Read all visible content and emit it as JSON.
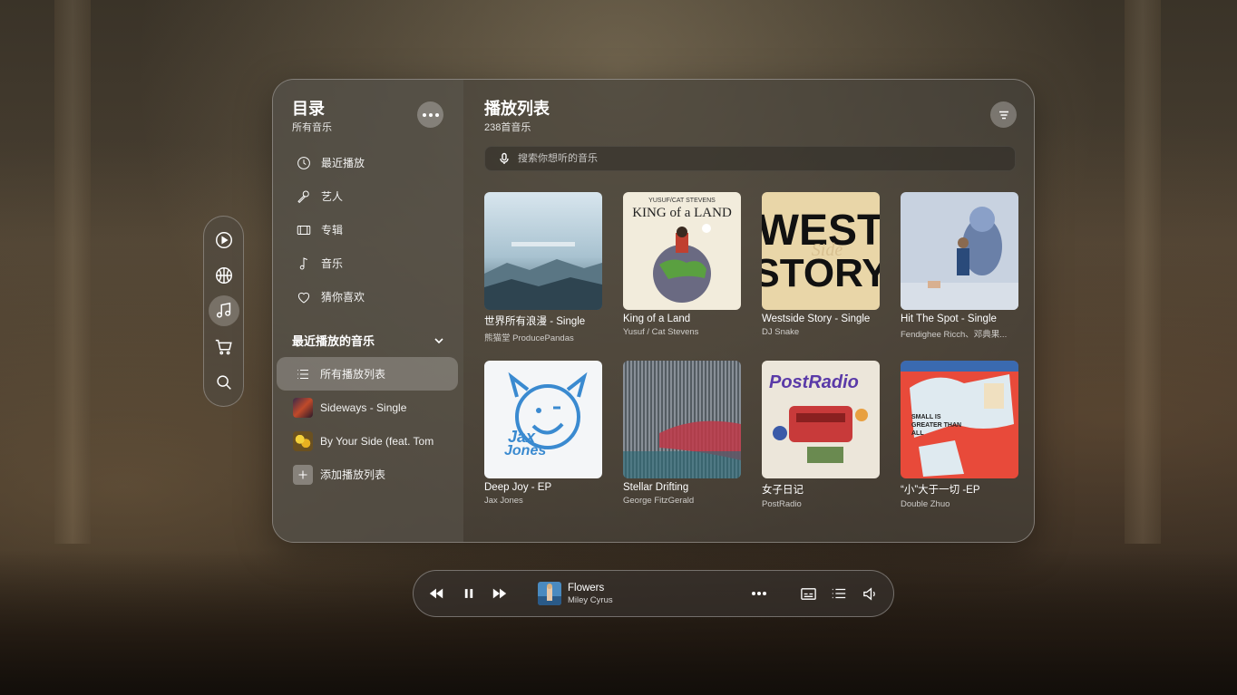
{
  "sidebar": {
    "title": "目录",
    "subtitle": "所有音乐",
    "menu": [
      {
        "label": "最近播放",
        "icon": "clock-icon"
      },
      {
        "label": "艺人",
        "icon": "microphone-icon"
      },
      {
        "label": "专辑",
        "icon": "album-icon"
      },
      {
        "label": "音乐",
        "icon": "music-note-icon"
      },
      {
        "label": "猜你喜欢",
        "icon": "heart-icon"
      }
    ],
    "section_title": "最近播放的音乐",
    "playlists": [
      {
        "label": "所有播放列表",
        "icon": "list-icon",
        "active": true
      },
      {
        "label": "Sideways - Single",
        "icon": "album-thumb"
      },
      {
        "label": "By Your Side (feat. Tom",
        "icon": "album-thumb"
      },
      {
        "label": "添加播放列表",
        "icon": "plus-icon"
      }
    ]
  },
  "content": {
    "title": "播放列表",
    "subtitle": "238首音乐",
    "search_placeholder": "搜索你想听的音乐",
    "albums": [
      {
        "title": "世界所有浪漫 - Single",
        "artist": "熊猫堂 ProducePandas"
      },
      {
        "title": "King of a Land",
        "artist": "Yusuf / Cat Stevens",
        "cover_text": "YUSUF/CAT STEVENS",
        "cover_text2": "KING of a LAND"
      },
      {
        "title": "Westside Story - Single",
        "artist": "DJ Snake",
        "cover_text": "WEST",
        "cover_text2": "STORY",
        "cover_text3": "Side"
      },
      {
        "title": "Hit The Spot - Single",
        "artist": "Fendighee Ricch、邓典果..."
      },
      {
        "title": "Deep Joy - EP",
        "artist": "Jax Jones",
        "cover_text": "Jax",
        "cover_text2": "Jones"
      },
      {
        "title": "Stellar Drifting",
        "artist": "George FitzGerald"
      },
      {
        "title": "女子日记",
        "artist": "PostRadio",
        "cover_text": "PostRadio"
      },
      {
        "title": "“小”大于一切 -EP",
        "artist": "Double Zhuo",
        "cover_text": "SMALL IS GREATER THAN ALL"
      }
    ]
  },
  "player": {
    "title": "Flowers",
    "artist": "Miley Cyrus"
  },
  "colors": {
    "panel": "#46423c",
    "accent": "#ffffff"
  }
}
